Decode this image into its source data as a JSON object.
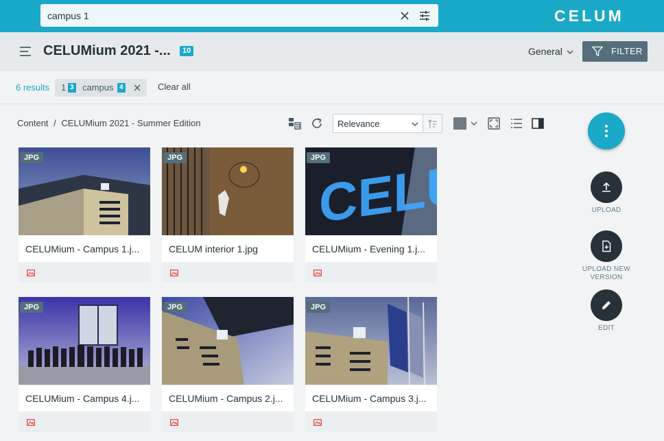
{
  "search": {
    "value": "campus 1"
  },
  "logo": {
    "text": "CELUM"
  },
  "header": {
    "title": "CELUMium 2021 -...",
    "count": "10",
    "view_select": "General",
    "filter_label": "FILTER"
  },
  "results_bar": {
    "results_text": "6 results",
    "chip": {
      "prefix": "1",
      "prefix_count": "3",
      "term": "campus",
      "term_count": "4"
    },
    "clear_all": "Clear all"
  },
  "breadcrumb": {
    "root": "Content",
    "separator": "/",
    "current": "CELUMium 2021 - Summer Edition"
  },
  "toolbar": {
    "sort_value": "Relevance"
  },
  "cards": [
    {
      "type": "JPG",
      "name": "CELUMium - Campus 1.j..."
    },
    {
      "type": "JPG",
      "name": "CELUM interior 1.jpg"
    },
    {
      "type": "JPG",
      "name": "CELUMium - Evening 1.j..."
    },
    {
      "type": "JPG",
      "name": "CELUMium - Campus 4.j..."
    },
    {
      "type": "JPG",
      "name": "CELUMium - Campus 2.j..."
    },
    {
      "type": "JPG",
      "name": "CELUMium - Campus 3.j..."
    }
  ],
  "actions": {
    "upload": "UPLOAD",
    "upload_new_version": "UPLOAD NEW VERSION",
    "edit": "EDIT"
  },
  "colors": {
    "brand": "#1aa9c8",
    "dark": "#263238",
    "slate": "#546e7a"
  }
}
